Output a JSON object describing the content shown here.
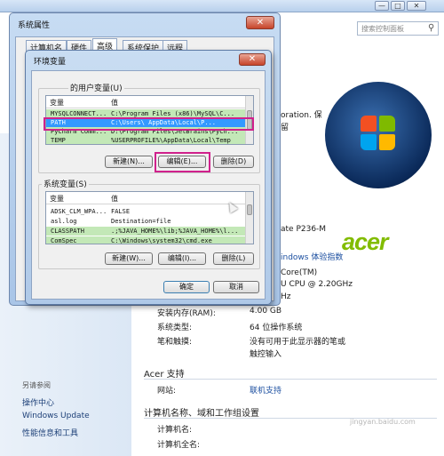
{
  "control_panel": {
    "search_placeholder": "搜索控制面板",
    "window_buttons": [
      "—",
      "□",
      "✕"
    ],
    "system_partial": {
      "oem_text": "oration. 保",
      "oem_text_2": "留",
      "model": "ate P236-M",
      "rating_link": "indows 体验指数",
      "processor_1": "Core(TM)",
      "processor_2": "U CPU @ 2.20GHz",
      "processor_3": "Hz"
    },
    "system_info": [
      {
        "key": "安装内存(RAM):",
        "value": "4.00 GB"
      },
      {
        "key": "系统类型:",
        "value": "64 位操作系统"
      },
      {
        "key": "笔和触摸:",
        "value": "没有可用于此显示器的笔或"
      },
      {
        "key": "",
        "value": "触控输入"
      }
    ],
    "support_section": {
      "title": "Acer 支持",
      "website_key": "网站:",
      "website_link": "联机支持"
    },
    "computer_section": {
      "title": "计算机名称、域和工作组设置",
      "name_key": "计算机名:",
      "full_name_key": "计算机全名:"
    },
    "sidebar": {
      "see_also": "另请参阅",
      "links": [
        "操作中心",
        "Windows Update",
        "性能信息和工具"
      ]
    },
    "logo_text": "acer",
    "watermark": "jingyan.baidu.com"
  },
  "system_properties": {
    "title": "系统属性",
    "close": "✕",
    "tabs": [
      "计算机名",
      "硬件",
      "高级",
      "系统保护",
      "远程"
    ],
    "active_tab": "高级"
  },
  "env_vars": {
    "title": "环境变量",
    "close": "✕",
    "user_group_label": "的用户变量(U)",
    "user_columns": [
      "变量",
      "值"
    ],
    "user_rows": [
      {
        "name": "MYSQLCONNECT...",
        "value": "C:\\Program Files (x86)\\MySQL\\C..."
      },
      {
        "name": "PATH",
        "value": "C:\\Users\\          AppData\\Local\\P..."
      },
      {
        "name": "PyCharm Comm...",
        "value": "D:\\Program Files\\JetBrains\\PyCh..."
      },
      {
        "name": "TEMP",
        "value": "%USERPROFILE%\\AppData\\Local\\Temp"
      }
    ],
    "user_buttons": [
      "新建(N)...",
      "编辑(E)...",
      "删除(D)"
    ],
    "system_group_label": "系统变量(S)",
    "system_columns": [
      "变量",
      "值"
    ],
    "system_rows": [
      {
        "name": "ADSK_CLM_WPA...",
        "value": "FALSE"
      },
      {
        "name": "asl.log",
        "value": "Destination=file"
      },
      {
        "name": "CLASSPATH",
        "value": ".;%JAVA_HOME%\\lib;%JAVA_HOME%\\l..."
      },
      {
        "name": "ComSpec",
        "value": "C:\\Windows\\system32\\cmd.exe"
      }
    ],
    "system_buttons": [
      "新建(W)...",
      "编辑(I)...",
      "删除(L)"
    ],
    "ok": "确定",
    "cancel": "取消"
  },
  "colors": {
    "highlight_box": "#d0218c",
    "selected_row": "#3399ff",
    "green_row": "#c3e8b7",
    "acer_green": "#82bc00"
  }
}
